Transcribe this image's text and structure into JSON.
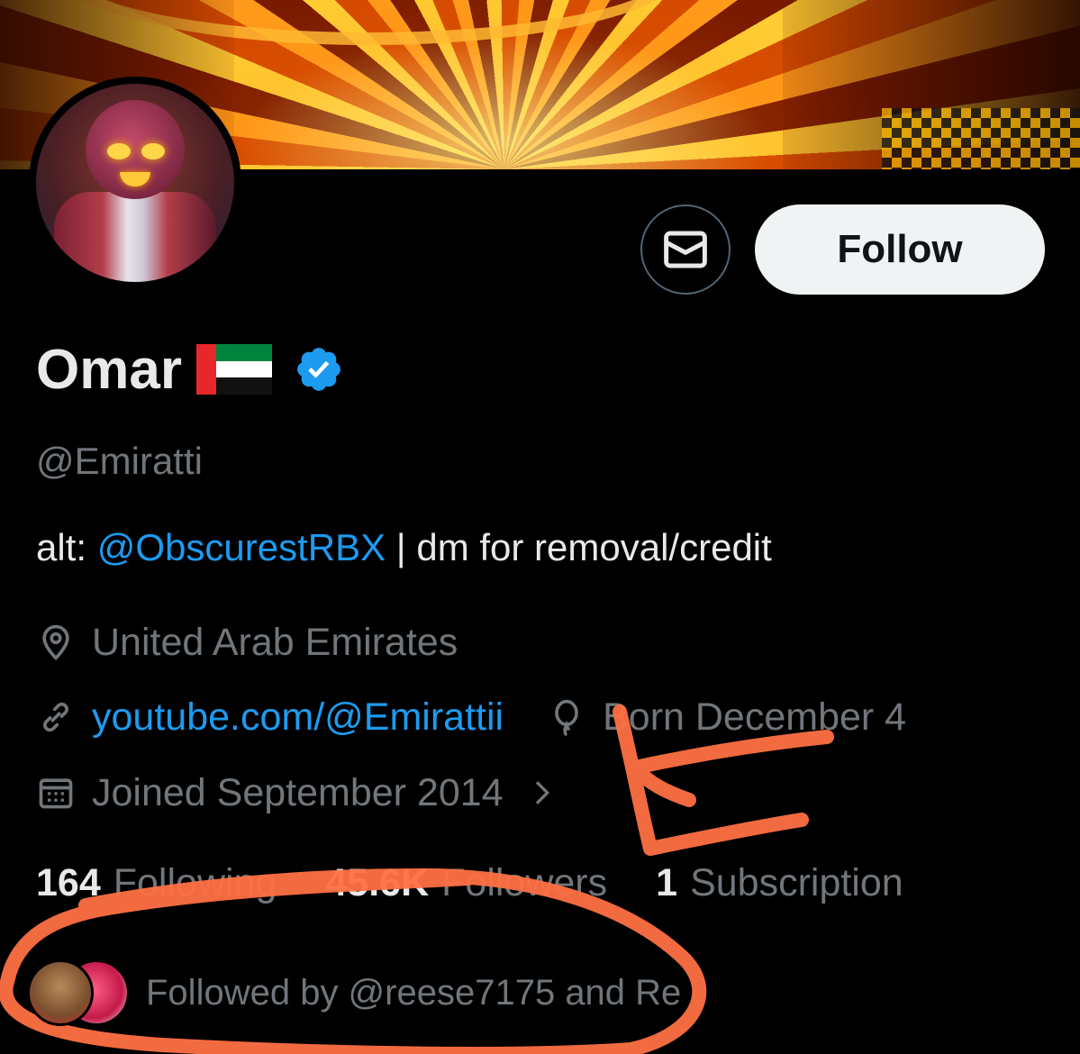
{
  "profile": {
    "name": "Omar",
    "handle": "@Emiratti",
    "bio_prefix": "alt: ",
    "bio_link": "@ObscurestRBX",
    "bio_suffix": " | dm for removal/credit",
    "location": "United Arab Emirates",
    "website": "youtube.com/@Emirattii",
    "birthday": "Born December 4",
    "joined": "Joined September 2014",
    "verified": true
  },
  "buttons": {
    "follow_label": "Follow"
  },
  "stats": {
    "following_count": "164",
    "following_label": "Following",
    "followers_count": "45.6K",
    "followers_label": "Followers",
    "subscriptions_count": "1",
    "subscriptions_label": "Subscription"
  },
  "followed_by": {
    "text": "Followed by @reese7175 and Re"
  },
  "icons": {
    "message": "envelope-icon",
    "verified": "verified-badge-icon",
    "location": "location-pin-icon",
    "link": "link-icon",
    "birthday": "balloon-icon",
    "joined": "calendar-icon",
    "chevron": "chevron-right-icon"
  },
  "colors": {
    "background": "#000000",
    "primary_text": "#e7e9ea",
    "secondary_text": "#71767b",
    "link": "#1d9bf0",
    "verified": "#1d9bf0",
    "follow_button_bg": "#eff3f4",
    "annotation": "#ff7043"
  }
}
